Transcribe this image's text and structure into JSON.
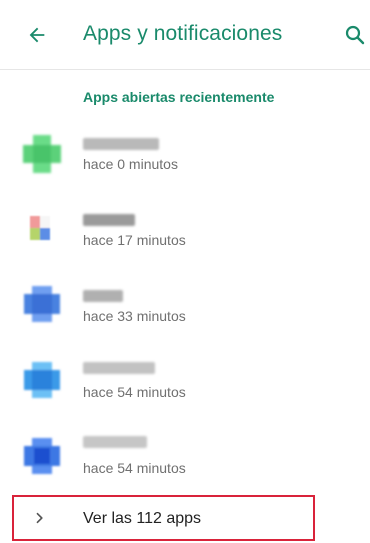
{
  "appbar": {
    "title": "Apps y notificaciones",
    "back_icon": "arrow-left-icon",
    "search_icon": "search-icon",
    "accent_color": "#1a8a6b"
  },
  "section": {
    "header": "Apps abiertas recientemente"
  },
  "recent_apps": [
    {
      "time": "hace 0 minutos",
      "icon_color": "#5cd17a"
    },
    {
      "time": "hace 17 minutos",
      "icon_color": "#e06060"
    },
    {
      "time": "hace 33 minutos",
      "icon_color": "#4a82e0"
    },
    {
      "time": "hace 54 minutos",
      "icon_color": "#3a9ae8"
    },
    {
      "time": "hace 54 minutos",
      "icon_color": "#2f6fe0"
    }
  ],
  "view_all": {
    "label": "Ver las 112 apps",
    "icon": "chevron-right-icon",
    "highlight_color": "#d9233a"
  }
}
